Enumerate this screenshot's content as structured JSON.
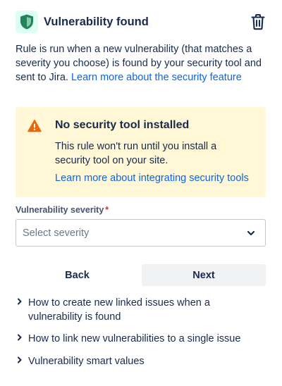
{
  "header": {
    "title": "Vulnerability found",
    "icon": "shield-icon",
    "delete_icon": "trash-icon"
  },
  "description": {
    "text": "Rule is run when a new vulnerability (that matches a severity you choose) is found by your security tool and sent to Jira. ",
    "link": "Learn more about the security feature"
  },
  "warning": {
    "icon": "warning-icon",
    "title": "No security tool installed",
    "body": "This rule won't run until you install a security tool on your site.",
    "link": "Learn more about integrating security tools"
  },
  "severity_field": {
    "label": "Vulnerability severity",
    "required_mark": "*",
    "placeholder": "Select severity"
  },
  "buttons": {
    "back": "Back",
    "next": "Next"
  },
  "help_links": [
    {
      "label": "How to create new linked issues when a vulnerability is found"
    },
    {
      "label": "How to link new vulnerabilities to a single issue"
    },
    {
      "label": "Vulnerability smart values"
    }
  ],
  "colors": {
    "link": "#0c66e4",
    "warning_bg": "#fff7d6",
    "warning_icon": "#e56910",
    "shield": "#1f845a",
    "shield_bg": "#dcfff1"
  }
}
